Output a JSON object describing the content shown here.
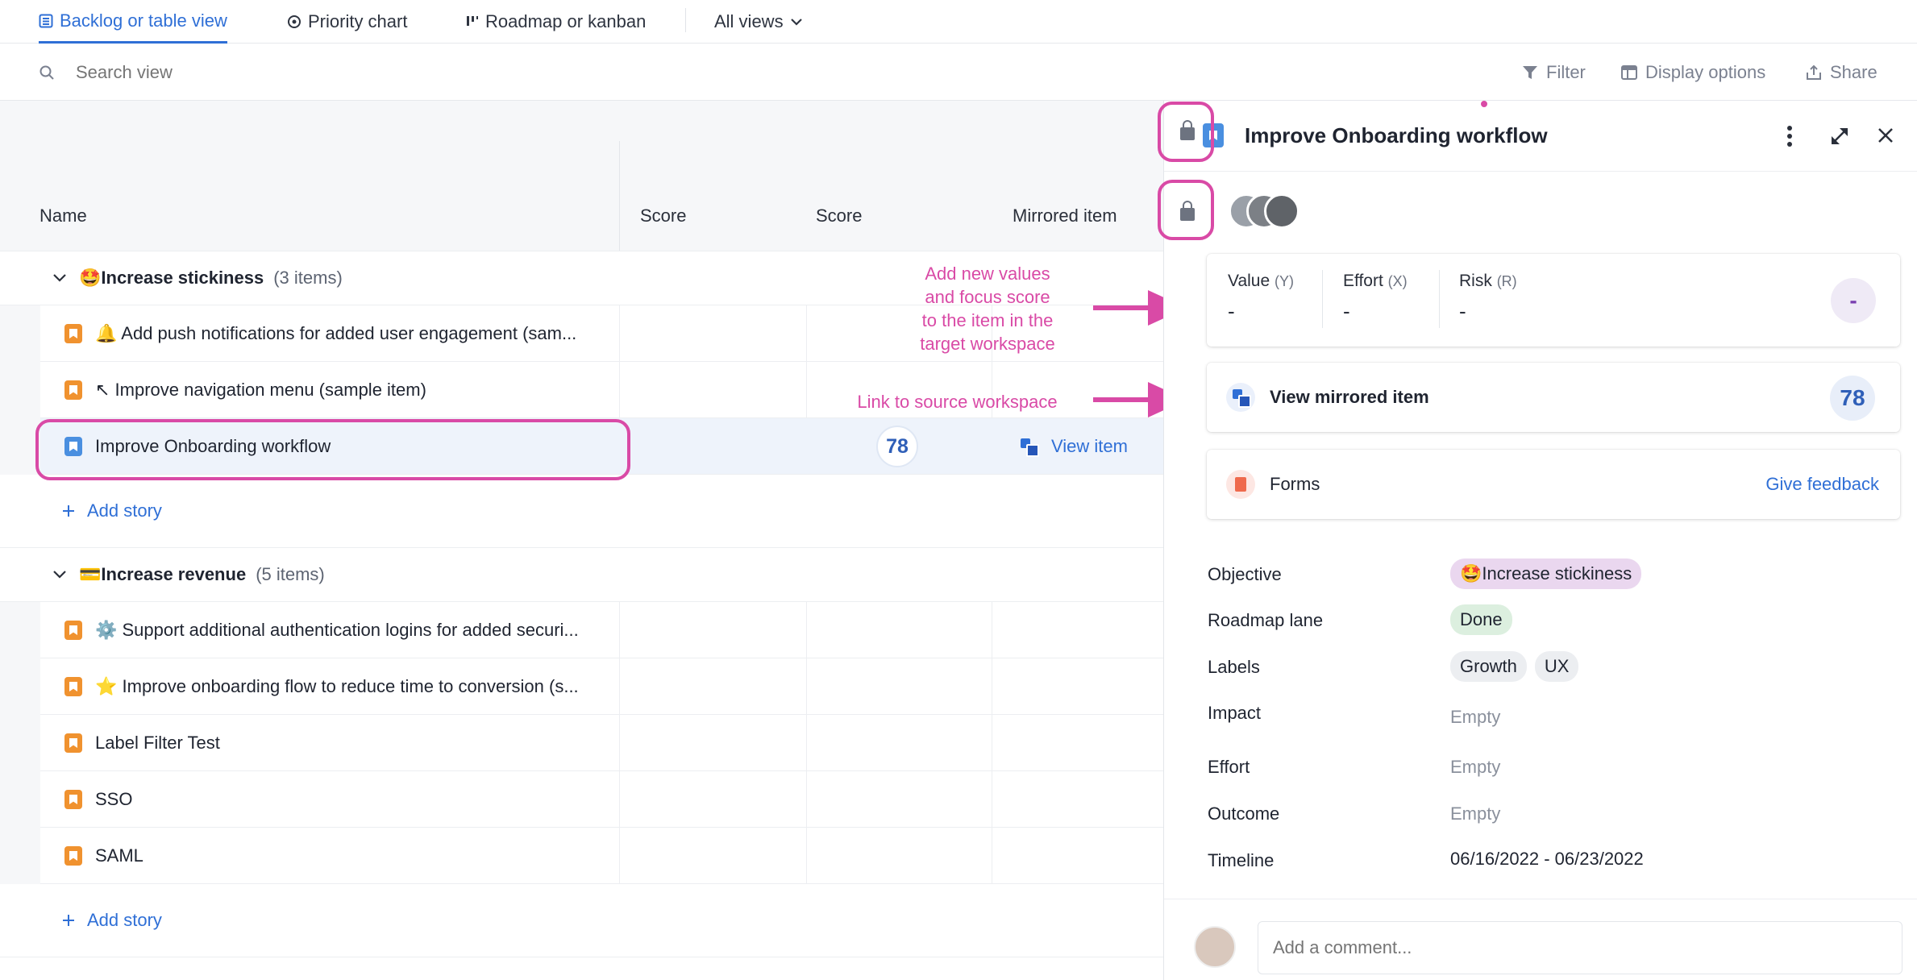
{
  "tabs": [
    {
      "label": "Backlog or table view",
      "icon": "table-icon",
      "active": true
    },
    {
      "label": "Priority chart",
      "icon": "target-icon",
      "active": false
    },
    {
      "label": "Roadmap or kanban",
      "icon": "kanban-icon",
      "active": false
    }
  ],
  "all_views_label": "All views",
  "search": {
    "placeholder": "Search view"
  },
  "toolbar": {
    "filter": "Filter",
    "display_options": "Display options",
    "share": "Share"
  },
  "table": {
    "columns": [
      "Name",
      "Score",
      "Score",
      "Mirrored item"
    ],
    "groups": [
      {
        "title": "🤩Increase stickiness",
        "count": "(3 items)",
        "rows": [
          {
            "name": "🔔 Add push notifications for added user engagement (sam...",
            "score": "",
            "mirror": ""
          },
          {
            "name": "↖ Improve navigation menu (sample item)",
            "score": "",
            "mirror": ""
          },
          {
            "name": "Improve Onboarding workflow",
            "score": "78",
            "mirror": "View item"
          }
        ],
        "add_label": "Add story"
      },
      {
        "title": "💳Increase revenue",
        "count": "(5 items)",
        "rows": [
          {
            "name": "⚙️ Support additional authentication logins for added securi...",
            "score": "",
            "mirror": ""
          },
          {
            "name": "⭐ Improve onboarding flow to reduce time to conversion (s...",
            "score": "",
            "mirror": ""
          },
          {
            "name": "Label Filter Test",
            "score": "",
            "mirror": ""
          },
          {
            "name": "SSO",
            "score": "",
            "mirror": ""
          },
          {
            "name": "SAML",
            "score": "",
            "mirror": ""
          }
        ],
        "add_label": "Add story"
      }
    ]
  },
  "annotations": {
    "values": "Add new values\nand focus score\nto the item in the\ntarget workspace",
    "link": "Link to source workspace"
  },
  "panel": {
    "title": "Improve Onboarding workflow",
    "score_card": {
      "fields": [
        {
          "label": "Value",
          "axis": "(Y)",
          "value": "-"
        },
        {
          "label": "Effort",
          "axis": "(X)",
          "value": "-"
        },
        {
          "label": "Risk",
          "axis": "(R)",
          "value": "-"
        }
      ],
      "score": "-"
    },
    "mirror_card": {
      "label": "View mirrored item",
      "score": "78"
    },
    "forms_card": {
      "label": "Forms",
      "action": "Give feedback"
    },
    "props": {
      "objective": {
        "label": "Objective",
        "value": "🤩Increase stickiness"
      },
      "roadmap_lane": {
        "label": "Roadmap lane",
        "value": "Done"
      },
      "labels": {
        "label": "Labels",
        "values": [
          "Growth",
          "UX"
        ]
      },
      "impact": {
        "label": "Impact",
        "value": "Empty"
      },
      "effort": {
        "label": "Effort",
        "value": "Empty"
      },
      "outcome": {
        "label": "Outcome",
        "value": "Empty"
      },
      "timeline": {
        "label": "Timeline",
        "value": "06/16/2022 - 06/23/2022"
      }
    },
    "comment_placeholder": "Add a comment..."
  },
  "colors": {
    "accent": "#2f6fd6",
    "annotation": "#d94aa6",
    "story_orange": "#f0922f",
    "story_blue": "#4a8fe0",
    "objective_chip": "#ead7ef",
    "done_chip": "#dcefdf",
    "label_chip": "#eceef1"
  }
}
